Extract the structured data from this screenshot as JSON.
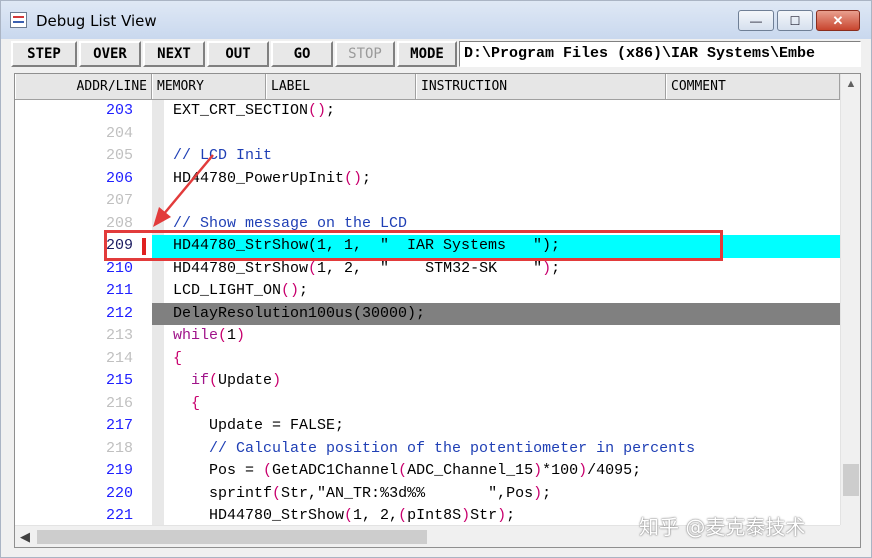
{
  "window": {
    "title": "Debug List View",
    "buttons": {
      "minimize": "—",
      "maximize": "☐",
      "close": "✕"
    }
  },
  "toolbar": {
    "step": "STEP",
    "over": "OVER",
    "next": "NEXT",
    "out": "OUT",
    "go": "GO",
    "stop": "STOP",
    "mode": "MODE",
    "path": "D:\\Program Files (x86)\\IAR Systems\\Embe"
  },
  "columns": {
    "addr": "ADDR/LINE",
    "memory": "MEMORY",
    "label": "LABEL",
    "instruction": "INSTRUCTION",
    "comment": "COMMENT"
  },
  "lines": [
    {
      "num": "203",
      "tokens": [
        [
          "t",
          "EXT_CRT_SECTION"
        ],
        [
          "p",
          "()"
        ],
        [
          "t",
          ";"
        ]
      ]
    },
    {
      "num": "204",
      "tokens": []
    },
    {
      "num": "205",
      "tokens": [
        [
          "c",
          "// LCD Init"
        ]
      ]
    },
    {
      "num": "206",
      "tokens": [
        [
          "t",
          "HD44780_PowerUpInit"
        ],
        [
          "p",
          "()"
        ],
        [
          "t",
          ";"
        ]
      ]
    },
    {
      "num": "207",
      "tokens": []
    },
    {
      "num": "208",
      "tokens": [
        [
          "c",
          "// Show message on the LCD"
        ]
      ]
    },
    {
      "num": "209",
      "tokens": [
        [
          "t",
          "HD44780_StrShow(1, 1,  \"  IAR Systems   \");"
        ]
      ]
    },
    {
      "num": "210",
      "tokens": [
        [
          "t",
          "HD44780_StrShow"
        ],
        [
          "p",
          "("
        ],
        [
          "t",
          "1, 2,  \"    STM32-SK    \""
        ],
        [
          "p",
          ")"
        ],
        [
          "t",
          ";"
        ]
      ]
    },
    {
      "num": "211",
      "tokens": [
        [
          "t",
          "LCD_LIGHT_ON"
        ],
        [
          "p",
          "()"
        ],
        [
          "t",
          ";"
        ]
      ]
    },
    {
      "num": "212",
      "tokens": [
        [
          "t",
          "DelayResolution100us(30000);"
        ]
      ]
    },
    {
      "num": "213",
      "tokens": [
        [
          "k",
          "while"
        ],
        [
          "p",
          "("
        ],
        [
          "t",
          "1"
        ],
        [
          "p",
          ")"
        ]
      ]
    },
    {
      "num": "214",
      "tokens": [
        [
          "p",
          "{"
        ]
      ]
    },
    {
      "num": "215",
      "tokens": [
        [
          "t",
          "  "
        ],
        [
          "k",
          "if"
        ],
        [
          "p",
          "("
        ],
        [
          "t",
          "Update"
        ],
        [
          "p",
          ")"
        ]
      ]
    },
    {
      "num": "216",
      "tokens": [
        [
          "t",
          "  "
        ],
        [
          "p",
          "{"
        ]
      ]
    },
    {
      "num": "217",
      "tokens": [
        [
          "t",
          "    Update = FALSE;"
        ]
      ]
    },
    {
      "num": "218",
      "tokens": [
        [
          "t",
          "    "
        ],
        [
          "c",
          "// Calculate position of the potentiometer in percents"
        ]
      ]
    },
    {
      "num": "219",
      "tokens": [
        [
          "t",
          "    Pos = "
        ],
        [
          "p",
          "("
        ],
        [
          "t",
          "GetADC1Channel"
        ],
        [
          "p",
          "("
        ],
        [
          "t",
          "ADC_Channel_15"
        ],
        [
          "p",
          ")"
        ],
        [
          "t",
          "*100"
        ],
        [
          "p",
          ")"
        ],
        [
          "t",
          "/4095;"
        ]
      ]
    },
    {
      "num": "220",
      "tokens": [
        [
          "t",
          "    sprintf"
        ],
        [
          "p",
          "("
        ],
        [
          "t",
          "Str,\"AN_TR:%3d%%       \",Pos"
        ],
        [
          "p",
          ")"
        ],
        [
          "t",
          ";"
        ]
      ]
    },
    {
      "num": "221",
      "tokens": [
        [
          "t",
          "    HD44780_StrShow"
        ],
        [
          "p",
          "("
        ],
        [
          "t",
          "1, 2,"
        ],
        [
          "p",
          "("
        ],
        [
          "t",
          "pInt8S"
        ],
        [
          "p",
          ")"
        ],
        [
          "t",
          "Str"
        ],
        [
          "p",
          ")"
        ],
        [
          "t",
          ";"
        ]
      ]
    }
  ],
  "line_num_colors": {
    "203": "blue",
    "204": "gray",
    "205": "gray",
    "206": "blue",
    "207": "gray",
    "208": "gray",
    "209": "blue",
    "210": "blue",
    "211": "blue",
    "212": "blue",
    "213": "gray",
    "214": "gray",
    "215": "blue",
    "216": "gray",
    "217": "blue",
    "218": "gray",
    "219": "blue",
    "220": "blue",
    "221": "blue"
  },
  "highlight": {
    "current_line": "209",
    "selected_line": "212",
    "cyan": "#00ffff",
    "gray": "#808080",
    "annotation_red": "#e23b3b"
  },
  "watermark": "知乎 @麦克泰技术"
}
